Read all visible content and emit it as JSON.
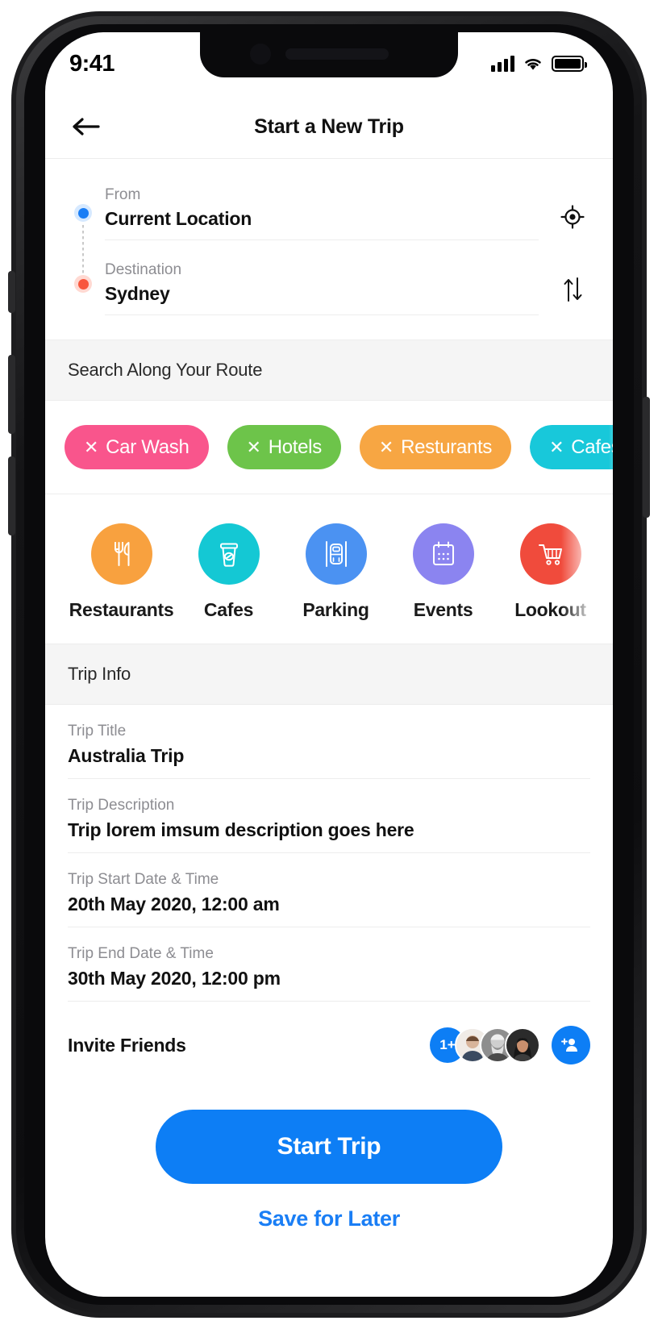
{
  "status_bar": {
    "time": "9:41",
    "signal_icon": "cellular-signal-icon",
    "wifi_icon": "wifi-icon",
    "battery_icon": "battery-full-icon"
  },
  "nav": {
    "back_icon": "arrow-left-icon",
    "title": "Start a New Trip"
  },
  "route": {
    "from": {
      "label": "From",
      "value": "Current Location",
      "dot": "origin-dot",
      "dot_color": "#1a7ef5"
    },
    "destination": {
      "label": "Destination",
      "value": "Sydney",
      "dot": "destination-dot",
      "dot_color": "#f8573d"
    },
    "gps_icon": "current-location-icon",
    "swap_icon": "swap-vertical-icon"
  },
  "search_section": {
    "title": "Search Along Your Route",
    "chips": [
      {
        "label": "Car Wash",
        "color": "#f9558c",
        "remove_icon": "close-icon"
      },
      {
        "label": "Hotels",
        "color": "#6dc44a",
        "remove_icon": "close-icon"
      },
      {
        "label": "Resturants",
        "color": "#f7a643",
        "remove_icon": "close-icon"
      },
      {
        "label": "Cafes",
        "color": "#18c8da",
        "remove_icon": "close-icon"
      }
    ]
  },
  "categories": [
    {
      "label": "Restaurants",
      "color": "#f8a13f",
      "icon": "cutlery-icon"
    },
    {
      "label": "Cafes",
      "color": "#14c8d4",
      "icon": "coffee-cup-icon"
    },
    {
      "label": "Parking",
      "color": "#4b92f2",
      "icon": "parking-car-icon"
    },
    {
      "label": "Events",
      "color": "#8b84f0",
      "icon": "calendar-icon"
    },
    {
      "label": "Lookout",
      "color": "#f04b3c",
      "icon": "shopping-cart-icon"
    }
  ],
  "trip_info": {
    "section_title": "Trip Info",
    "fields": [
      {
        "label": "Trip Title",
        "value": "Australia Trip"
      },
      {
        "label": "Trip Description",
        "value": "Trip lorem imsum description goes here"
      },
      {
        "label": "Trip Start Date & Time",
        "value": "20th May 2020, 12:00 am"
      },
      {
        "label": "Trip End Date & Time",
        "value": "30th May 2020, 12:00 pm"
      }
    ]
  },
  "invite": {
    "label": "Invite Friends",
    "overflow_count": "1+",
    "avatar_count": 3,
    "add_icon": "add-person-icon"
  },
  "footer": {
    "primary_label": "Start Trip",
    "secondary_label": "Save for Later",
    "accent_color": "#0d7ef5"
  }
}
